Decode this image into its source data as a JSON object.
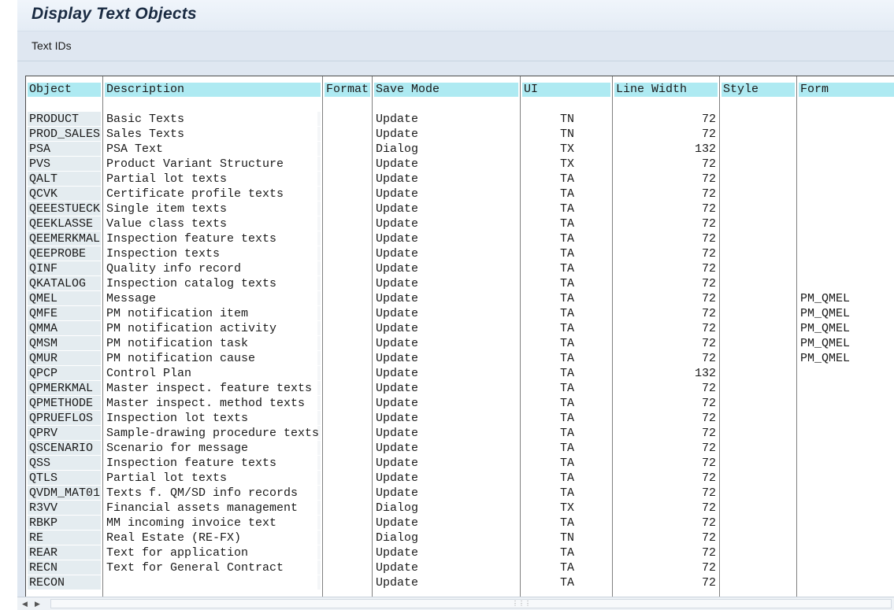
{
  "window": {
    "title": "Display Text Objects"
  },
  "toolbar": {
    "text_ids_label": "Text IDs"
  },
  "table": {
    "headers": {
      "object": "Object",
      "description": "Description",
      "format": "Format",
      "save_mode": "Save Mode",
      "ui": "UI",
      "line_width": "Line Width",
      "style": "Style",
      "form": "Form"
    },
    "rows": [
      {
        "object": "PRODUCT",
        "description": "Basic Texts",
        "format": "",
        "save_mode": "Update",
        "ui": "TN",
        "line_width": "72",
        "style": "",
        "form": ""
      },
      {
        "object": "PROD_SALES",
        "description": "Sales Texts",
        "format": "",
        "save_mode": "Update",
        "ui": "TN",
        "line_width": "72",
        "style": "",
        "form": ""
      },
      {
        "object": "PSA",
        "description": "PSA Text",
        "format": "",
        "save_mode": "Dialog",
        "ui": "TX",
        "line_width": "132",
        "style": "",
        "form": ""
      },
      {
        "object": "PVS",
        "description": "Product Variant Structure",
        "format": "",
        "save_mode": "Update",
        "ui": "TX",
        "line_width": "72",
        "style": "",
        "form": ""
      },
      {
        "object": "QALT",
        "description": "Partial lot texts",
        "format": "",
        "save_mode": "Update",
        "ui": "TA",
        "line_width": "72",
        "style": "",
        "form": ""
      },
      {
        "object": "QCVK",
        "description": "Certificate profile texts",
        "format": "",
        "save_mode": "Update",
        "ui": "TA",
        "line_width": "72",
        "style": "",
        "form": ""
      },
      {
        "object": "QEEESTUECK",
        "description": "Single item texts",
        "format": "",
        "save_mode": "Update",
        "ui": "TA",
        "line_width": "72",
        "style": "",
        "form": ""
      },
      {
        "object": "QEEKLASSE",
        "description": "Value class texts",
        "format": "",
        "save_mode": "Update",
        "ui": "TA",
        "line_width": "72",
        "style": "",
        "form": ""
      },
      {
        "object": "QEEMERKMAL",
        "description": "Inspection feature texts",
        "format": "",
        "save_mode": "Update",
        "ui": "TA",
        "line_width": "72",
        "style": "",
        "form": ""
      },
      {
        "object": "QEEPROBE",
        "description": "Inspection texts",
        "format": "",
        "save_mode": "Update",
        "ui": "TA",
        "line_width": "72",
        "style": "",
        "form": ""
      },
      {
        "object": "QINF",
        "description": "Quality info record",
        "format": "",
        "save_mode": "Update",
        "ui": "TA",
        "line_width": "72",
        "style": "",
        "form": ""
      },
      {
        "object": "QKATALOG",
        "description": "Inspection catalog texts",
        "format": "",
        "save_mode": "Update",
        "ui": "TA",
        "line_width": "72",
        "style": "",
        "form": ""
      },
      {
        "object": "QMEL",
        "description": "Message",
        "format": "",
        "save_mode": "Update",
        "ui": "TA",
        "line_width": "72",
        "style": "",
        "form": "PM_QMEL"
      },
      {
        "object": "QMFE",
        "description": "PM notification item",
        "format": "",
        "save_mode": "Update",
        "ui": "TA",
        "line_width": "72",
        "style": "",
        "form": "PM_QMEL"
      },
      {
        "object": "QMMA",
        "description": "PM notification activity",
        "format": "",
        "save_mode": "Update",
        "ui": "TA",
        "line_width": "72",
        "style": "",
        "form": "PM_QMEL"
      },
      {
        "object": "QMSM",
        "description": "PM notification task",
        "format": "",
        "save_mode": "Update",
        "ui": "TA",
        "line_width": "72",
        "style": "",
        "form": "PM_QMEL"
      },
      {
        "object": "QMUR",
        "description": "PM notification cause",
        "format": "",
        "save_mode": "Update",
        "ui": "TA",
        "line_width": "72",
        "style": "",
        "form": "PM_QMEL"
      },
      {
        "object": "QPCP",
        "description": "Control Plan",
        "format": "",
        "save_mode": "Update",
        "ui": "TA",
        "line_width": "132",
        "style": "",
        "form": ""
      },
      {
        "object": "QPMERKMAL",
        "description": "Master inspect. feature texts",
        "format": "",
        "save_mode": "Update",
        "ui": "TA",
        "line_width": "72",
        "style": "",
        "form": ""
      },
      {
        "object": "QPMETHODE",
        "description": "Master inspect. method texts",
        "format": "",
        "save_mode": "Update",
        "ui": "TA",
        "line_width": "72",
        "style": "",
        "form": ""
      },
      {
        "object": "QPRUEFLOS",
        "description": "Inspection lot texts",
        "format": "",
        "save_mode": "Update",
        "ui": "TA",
        "line_width": "72",
        "style": "",
        "form": ""
      },
      {
        "object": "QPRV",
        "description": "Sample-drawing procedure texts",
        "format": "",
        "save_mode": "Update",
        "ui": "TA",
        "line_width": "72",
        "style": "",
        "form": ""
      },
      {
        "object": "QSCENARIO",
        "description": "Scenario for message",
        "format": "",
        "save_mode": "Update",
        "ui": "TA",
        "line_width": "72",
        "style": "",
        "form": ""
      },
      {
        "object": "QSS",
        "description": "Inspection feature texts",
        "format": "",
        "save_mode": "Update",
        "ui": "TA",
        "line_width": "72",
        "style": "",
        "form": ""
      },
      {
        "object": "QTLS",
        "description": "Partial lot texts",
        "format": "",
        "save_mode": "Update",
        "ui": "TA",
        "line_width": "72",
        "style": "",
        "form": ""
      },
      {
        "object": "QVDM_MAT01",
        "description": "Texts f. QM/SD info records",
        "format": "",
        "save_mode": "Update",
        "ui": "TA",
        "line_width": "72",
        "style": "",
        "form": ""
      },
      {
        "object": "R3VV",
        "description": "Financial assets management",
        "format": "",
        "save_mode": "Dialog",
        "ui": "TX",
        "line_width": "72",
        "style": "",
        "form": ""
      },
      {
        "object": "RBKP",
        "description": "MM incoming invoice text",
        "format": "",
        "save_mode": "Update",
        "ui": "TA",
        "line_width": "72",
        "style": "",
        "form": ""
      },
      {
        "object": "RE",
        "description": "Real Estate  (RE-FX)",
        "format": "",
        "save_mode": "Dialog",
        "ui": "TN",
        "line_width": "72",
        "style": "",
        "form": ""
      },
      {
        "object": "REAR",
        "description": "Text for application",
        "format": "",
        "save_mode": "Update",
        "ui": "TA",
        "line_width": "72",
        "style": "",
        "form": ""
      },
      {
        "object": "RECN",
        "description": "Text for General Contract",
        "format": "",
        "save_mode": "Update",
        "ui": "TA",
        "line_width": "72",
        "style": "",
        "form": ""
      },
      {
        "object": "RECON",
        "description": "",
        "format": "",
        "save_mode": "Update",
        "ui": "TA",
        "line_width": "72",
        "style": "",
        "form": ""
      }
    ]
  },
  "icons": {
    "scroll_left": "arrow-left-icon",
    "scroll_right": "arrow-right-icon",
    "grip": "scroll-grip-icon"
  },
  "colors": {
    "header_bg": "#aeeaf2",
    "key_column_bg": "#e4ecf0",
    "frame_bg": "#dfe7f1",
    "title_text": "#1a2b42"
  }
}
